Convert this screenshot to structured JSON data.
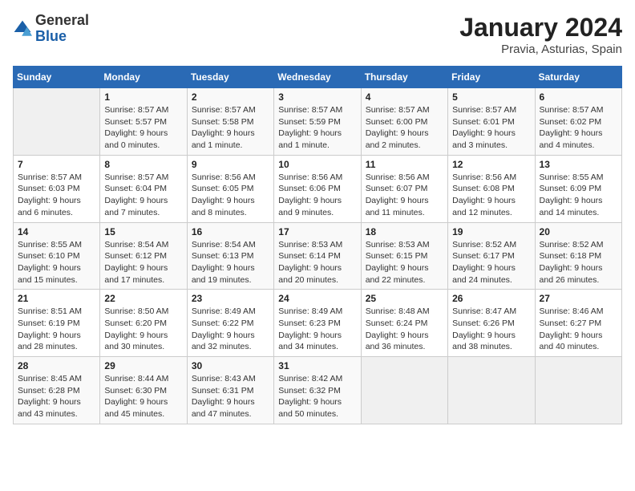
{
  "logo": {
    "general": "General",
    "blue": "Blue"
  },
  "title": "January 2024",
  "subtitle": "Pravia, Asturias, Spain",
  "weekdays": [
    "Sunday",
    "Monday",
    "Tuesday",
    "Wednesday",
    "Thursday",
    "Friday",
    "Saturday"
  ],
  "weeks": [
    [
      {
        "day": "",
        "sunrise": "",
        "sunset": "",
        "daylight": ""
      },
      {
        "day": "1",
        "sunrise": "Sunrise: 8:57 AM",
        "sunset": "Sunset: 5:57 PM",
        "daylight": "Daylight: 9 hours and 0 minutes."
      },
      {
        "day": "2",
        "sunrise": "Sunrise: 8:57 AM",
        "sunset": "Sunset: 5:58 PM",
        "daylight": "Daylight: 9 hours and 1 minute."
      },
      {
        "day": "3",
        "sunrise": "Sunrise: 8:57 AM",
        "sunset": "Sunset: 5:59 PM",
        "daylight": "Daylight: 9 hours and 1 minute."
      },
      {
        "day": "4",
        "sunrise": "Sunrise: 8:57 AM",
        "sunset": "Sunset: 6:00 PM",
        "daylight": "Daylight: 9 hours and 2 minutes."
      },
      {
        "day": "5",
        "sunrise": "Sunrise: 8:57 AM",
        "sunset": "Sunset: 6:01 PM",
        "daylight": "Daylight: 9 hours and 3 minutes."
      },
      {
        "day": "6",
        "sunrise": "Sunrise: 8:57 AM",
        "sunset": "Sunset: 6:02 PM",
        "daylight": "Daylight: 9 hours and 4 minutes."
      }
    ],
    [
      {
        "day": "7",
        "sunrise": "Sunrise: 8:57 AM",
        "sunset": "Sunset: 6:03 PM",
        "daylight": "Daylight: 9 hours and 6 minutes."
      },
      {
        "day": "8",
        "sunrise": "Sunrise: 8:57 AM",
        "sunset": "Sunset: 6:04 PM",
        "daylight": "Daylight: 9 hours and 7 minutes."
      },
      {
        "day": "9",
        "sunrise": "Sunrise: 8:56 AM",
        "sunset": "Sunset: 6:05 PM",
        "daylight": "Daylight: 9 hours and 8 minutes."
      },
      {
        "day": "10",
        "sunrise": "Sunrise: 8:56 AM",
        "sunset": "Sunset: 6:06 PM",
        "daylight": "Daylight: 9 hours and 9 minutes."
      },
      {
        "day": "11",
        "sunrise": "Sunrise: 8:56 AM",
        "sunset": "Sunset: 6:07 PM",
        "daylight": "Daylight: 9 hours and 11 minutes."
      },
      {
        "day": "12",
        "sunrise": "Sunrise: 8:56 AM",
        "sunset": "Sunset: 6:08 PM",
        "daylight": "Daylight: 9 hours and 12 minutes."
      },
      {
        "day": "13",
        "sunrise": "Sunrise: 8:55 AM",
        "sunset": "Sunset: 6:09 PM",
        "daylight": "Daylight: 9 hours and 14 minutes."
      }
    ],
    [
      {
        "day": "14",
        "sunrise": "Sunrise: 8:55 AM",
        "sunset": "Sunset: 6:10 PM",
        "daylight": "Daylight: 9 hours and 15 minutes."
      },
      {
        "day": "15",
        "sunrise": "Sunrise: 8:54 AM",
        "sunset": "Sunset: 6:12 PM",
        "daylight": "Daylight: 9 hours and 17 minutes."
      },
      {
        "day": "16",
        "sunrise": "Sunrise: 8:54 AM",
        "sunset": "Sunset: 6:13 PM",
        "daylight": "Daylight: 9 hours and 19 minutes."
      },
      {
        "day": "17",
        "sunrise": "Sunrise: 8:53 AM",
        "sunset": "Sunset: 6:14 PM",
        "daylight": "Daylight: 9 hours and 20 minutes."
      },
      {
        "day": "18",
        "sunrise": "Sunrise: 8:53 AM",
        "sunset": "Sunset: 6:15 PM",
        "daylight": "Daylight: 9 hours and 22 minutes."
      },
      {
        "day": "19",
        "sunrise": "Sunrise: 8:52 AM",
        "sunset": "Sunset: 6:17 PM",
        "daylight": "Daylight: 9 hours and 24 minutes."
      },
      {
        "day": "20",
        "sunrise": "Sunrise: 8:52 AM",
        "sunset": "Sunset: 6:18 PM",
        "daylight": "Daylight: 9 hours and 26 minutes."
      }
    ],
    [
      {
        "day": "21",
        "sunrise": "Sunrise: 8:51 AM",
        "sunset": "Sunset: 6:19 PM",
        "daylight": "Daylight: 9 hours and 28 minutes."
      },
      {
        "day": "22",
        "sunrise": "Sunrise: 8:50 AM",
        "sunset": "Sunset: 6:20 PM",
        "daylight": "Daylight: 9 hours and 30 minutes."
      },
      {
        "day": "23",
        "sunrise": "Sunrise: 8:49 AM",
        "sunset": "Sunset: 6:22 PM",
        "daylight": "Daylight: 9 hours and 32 minutes."
      },
      {
        "day": "24",
        "sunrise": "Sunrise: 8:49 AM",
        "sunset": "Sunset: 6:23 PM",
        "daylight": "Daylight: 9 hours and 34 minutes."
      },
      {
        "day": "25",
        "sunrise": "Sunrise: 8:48 AM",
        "sunset": "Sunset: 6:24 PM",
        "daylight": "Daylight: 9 hours and 36 minutes."
      },
      {
        "day": "26",
        "sunrise": "Sunrise: 8:47 AM",
        "sunset": "Sunset: 6:26 PM",
        "daylight": "Daylight: 9 hours and 38 minutes."
      },
      {
        "day": "27",
        "sunrise": "Sunrise: 8:46 AM",
        "sunset": "Sunset: 6:27 PM",
        "daylight": "Daylight: 9 hours and 40 minutes."
      }
    ],
    [
      {
        "day": "28",
        "sunrise": "Sunrise: 8:45 AM",
        "sunset": "Sunset: 6:28 PM",
        "daylight": "Daylight: 9 hours and 43 minutes."
      },
      {
        "day": "29",
        "sunrise": "Sunrise: 8:44 AM",
        "sunset": "Sunset: 6:30 PM",
        "daylight": "Daylight: 9 hours and 45 minutes."
      },
      {
        "day": "30",
        "sunrise": "Sunrise: 8:43 AM",
        "sunset": "Sunset: 6:31 PM",
        "daylight": "Daylight: 9 hours and 47 minutes."
      },
      {
        "day": "31",
        "sunrise": "Sunrise: 8:42 AM",
        "sunset": "Sunset: 6:32 PM",
        "daylight": "Daylight: 9 hours and 50 minutes."
      },
      {
        "day": "",
        "sunrise": "",
        "sunset": "",
        "daylight": ""
      },
      {
        "day": "",
        "sunrise": "",
        "sunset": "",
        "daylight": ""
      },
      {
        "day": "",
        "sunrise": "",
        "sunset": "",
        "daylight": ""
      }
    ]
  ]
}
